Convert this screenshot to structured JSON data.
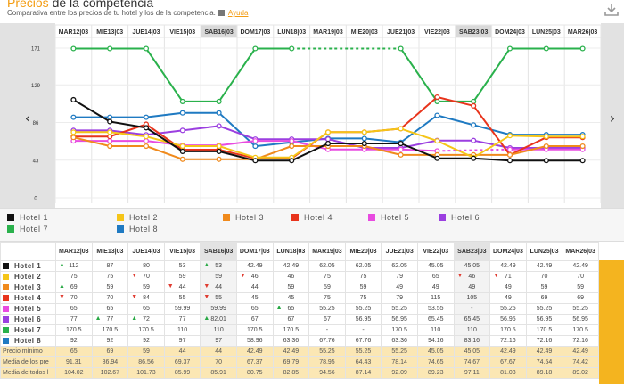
{
  "header": {
    "title_prefix": "Precios",
    "title_rest": " de la competencia",
    "subtitle": "Comparativa entre los precios de tu hotel y los de la competencia.",
    "help_label": "Ayuda",
    "download_icon": "download-icon"
  },
  "colors": {
    "accent": "#f39c12",
    "weekend_header": "#e3e3e3",
    "summary_bg": "#fbe7b4",
    "right_bar": "#f4b41f"
  },
  "chart_data": {
    "type": "line",
    "categories": [
      "MAR12|03",
      "MIE13|03",
      "JUE14|03",
      "VIE15|03",
      "SAB16|03",
      "DOM17|03",
      "LUN18|03",
      "MAR19|03",
      "MIE20|03",
      "JUE21|03",
      "VIE22|03",
      "SAB23|03",
      "DOM24|03",
      "LUN25|03",
      "MAR26|03"
    ],
    "weekend_categories": [
      4,
      11
    ],
    "yticks": [
      0,
      43,
      86,
      129,
      171
    ],
    "ylim": [
      0,
      171
    ],
    "grid": true,
    "legend_position": "bottom",
    "series": [
      {
        "name": "Hotel 1",
        "color": "#111111",
        "values": [
          112,
          87,
          80,
          53,
          53,
          42.49,
          42.49,
          62.05,
          62.05,
          62.05,
          45.05,
          45.05,
          42.49,
          42.49,
          42.49
        ]
      },
      {
        "name": "Hotel 2",
        "color": "#f5c518",
        "values": [
          75,
          75,
          70,
          59,
          59,
          46,
          46,
          75,
          75,
          79,
          65,
          46,
          71,
          70,
          70
        ]
      },
      {
        "name": "Hotel 3",
        "color": "#f08a1c",
        "values": [
          69,
          59,
          59,
          44,
          44,
          44,
          59,
          59,
          59,
          49,
          49,
          49,
          49,
          59,
          59
        ]
      },
      {
        "name": "Hotel 4",
        "color": "#e8341c",
        "values": [
          70,
          70,
          84,
          55,
          55,
          45,
          45,
          75,
          75,
          79,
          115,
          105,
          49,
          69,
          69
        ]
      },
      {
        "name": "Hotel 5",
        "color": "#e84be0",
        "values": [
          65,
          65,
          65,
          59.99,
          59.99,
          65,
          65,
          55.25,
          55.25,
          55.25,
          53.55,
          null,
          55.25,
          55.25,
          55.25
        ]
      },
      {
        "name": "Hotel 6",
        "color": "#9b3fe0",
        "values": [
          77,
          77,
          72,
          77,
          82.01,
          67,
          67,
          67,
          56.95,
          56.95,
          65.45,
          65.45,
          56.95,
          56.95,
          56.95
        ]
      },
      {
        "name": "Hotel 7",
        "color": "#2ab14c",
        "values": [
          170.5,
          170.5,
          170.5,
          110,
          110,
          170.5,
          170.5,
          null,
          null,
          170.5,
          110,
          110,
          170.5,
          170.5,
          170.5
        ]
      },
      {
        "name": "Hotel 8",
        "color": "#1f7ac2",
        "values": [
          92,
          92,
          92,
          97,
          97,
          58.96,
          63.36,
          67.76,
          67.76,
          63.36,
          94.16,
          83.16,
          72.16,
          72.16,
          72.16
        ]
      }
    ]
  },
  "table": {
    "header_blank": "",
    "rows": [
      {
        "label": "Hotel 1",
        "color": "#111111",
        "cells": [
          "112",
          "87",
          "80",
          "53",
          "53",
          "42.49",
          "42.49",
          "62.05",
          "62.05",
          "62.05",
          "45.05",
          "45.05",
          "42.49",
          "42.49",
          "42.49"
        ],
        "arrows": [
          "up",
          "",
          "",
          "",
          "up",
          "",
          "",
          "",
          "",
          "",
          "",
          "",
          "",
          "",
          ""
        ]
      },
      {
        "label": "Hotel 2",
        "color": "#f5c518",
        "cells": [
          "75",
          "75",
          "70",
          "59",
          "59",
          "46",
          "46",
          "75",
          "75",
          "79",
          "65",
          "46",
          "71",
          "70",
          "70"
        ],
        "arrows": [
          "",
          "",
          "down",
          "",
          "",
          "down",
          "",
          "",
          "",
          "",
          "",
          "down",
          "down",
          "",
          ""
        ]
      },
      {
        "label": "Hotel 3",
        "color": "#f08a1c",
        "cells": [
          "69",
          "59",
          "59",
          "44",
          "44",
          "44",
          "59",
          "59",
          "59",
          "49",
          "49",
          "49",
          "49",
          "59",
          "59"
        ],
        "arrows": [
          "up",
          "",
          "",
          "down",
          "down",
          "",
          "",
          "",
          "",
          "",
          "",
          "",
          "",
          "",
          ""
        ]
      },
      {
        "label": "Hotel 4",
        "color": "#e8341c",
        "cells": [
          "70",
          "70",
          "84",
          "55",
          "55",
          "45",
          "45",
          "75",
          "75",
          "79",
          "115",
          "105",
          "49",
          "69",
          "69"
        ],
        "arrows": [
          "down",
          "",
          "down",
          "",
          "down",
          "",
          "",
          "",
          "",
          "",
          "",
          "",
          "",
          "",
          ""
        ]
      },
      {
        "label": "Hotel 5",
        "color": "#e84be0",
        "cells": [
          "65",
          "65",
          "65",
          "59.99",
          "59.99",
          "65",
          "65",
          "55.25",
          "55.25",
          "55.25",
          "53.55",
          "-",
          "55.25",
          "55.25",
          "55.25"
        ],
        "arrows": [
          "",
          "",
          "",
          "",
          "",
          "",
          "up",
          "",
          "",
          "",
          "",
          "",
          "",
          "",
          ""
        ]
      },
      {
        "label": "Hotel 6",
        "color": "#9b3fe0",
        "cells": [
          "77",
          "77",
          "72",
          "77",
          "82.01",
          "67",
          "67",
          "67",
          "56.95",
          "56.95",
          "65.45",
          "65.45",
          "56.95",
          "56.95",
          "56.95"
        ],
        "arrows": [
          "",
          "up",
          "up",
          "",
          "up",
          "",
          "",
          "",
          "",
          "",
          "",
          "",
          "",
          "",
          ""
        ]
      },
      {
        "label": "Hotel 7",
        "color": "#2ab14c",
        "cells": [
          "170.5",
          "170.5",
          "170.5",
          "110",
          "110",
          "170.5",
          "170.5",
          "-",
          "-",
          "170.5",
          "110",
          "110",
          "170.5",
          "170.5",
          "170.5"
        ],
        "arrows": [
          "",
          "",
          "",
          "",
          "",
          "",
          "",
          "",
          "",
          "",
          "",
          "",
          "",
          "",
          ""
        ]
      },
      {
        "label": "Hotel 8",
        "color": "#1f7ac2",
        "cells": [
          "92",
          "92",
          "92",
          "97",
          "97",
          "58.96",
          "63.36",
          "67.76",
          "67.76",
          "63.36",
          "94.16",
          "83.16",
          "72.16",
          "72.16",
          "72.16"
        ],
        "arrows": [
          "",
          "",
          "",
          "",
          "",
          "",
          "",
          "",
          "",
          "",
          "",
          "",
          "",
          "",
          ""
        ]
      }
    ],
    "summary_rows": [
      {
        "label": "Precio mínimo",
        "cells": [
          "65",
          "69",
          "59",
          "44",
          "44",
          "42.49",
          "42.49",
          "55.25",
          "55.25",
          "55.25",
          "45.05",
          "45.05",
          "42.49",
          "42.49",
          "42.49"
        ]
      },
      {
        "label": "Media de los pre",
        "cells": [
          "91.31",
          "86.94",
          "86.56",
          "69.37",
          "70",
          "67.37",
          "69.79",
          "78.95",
          "64.43",
          "78.14",
          "74.65",
          "74.67",
          "67.67",
          "74.54",
          "74.42"
        ]
      },
      {
        "label": "Media de todos l",
        "cells": [
          "104.02",
          "102.67",
          "101.73",
          "85.99",
          "85.91",
          "80.75",
          "82.85",
          "94.56",
          "87.14",
          "92.09",
          "89.23",
          "97.11",
          "81.03",
          "89.18",
          "89.02"
        ]
      }
    ]
  }
}
